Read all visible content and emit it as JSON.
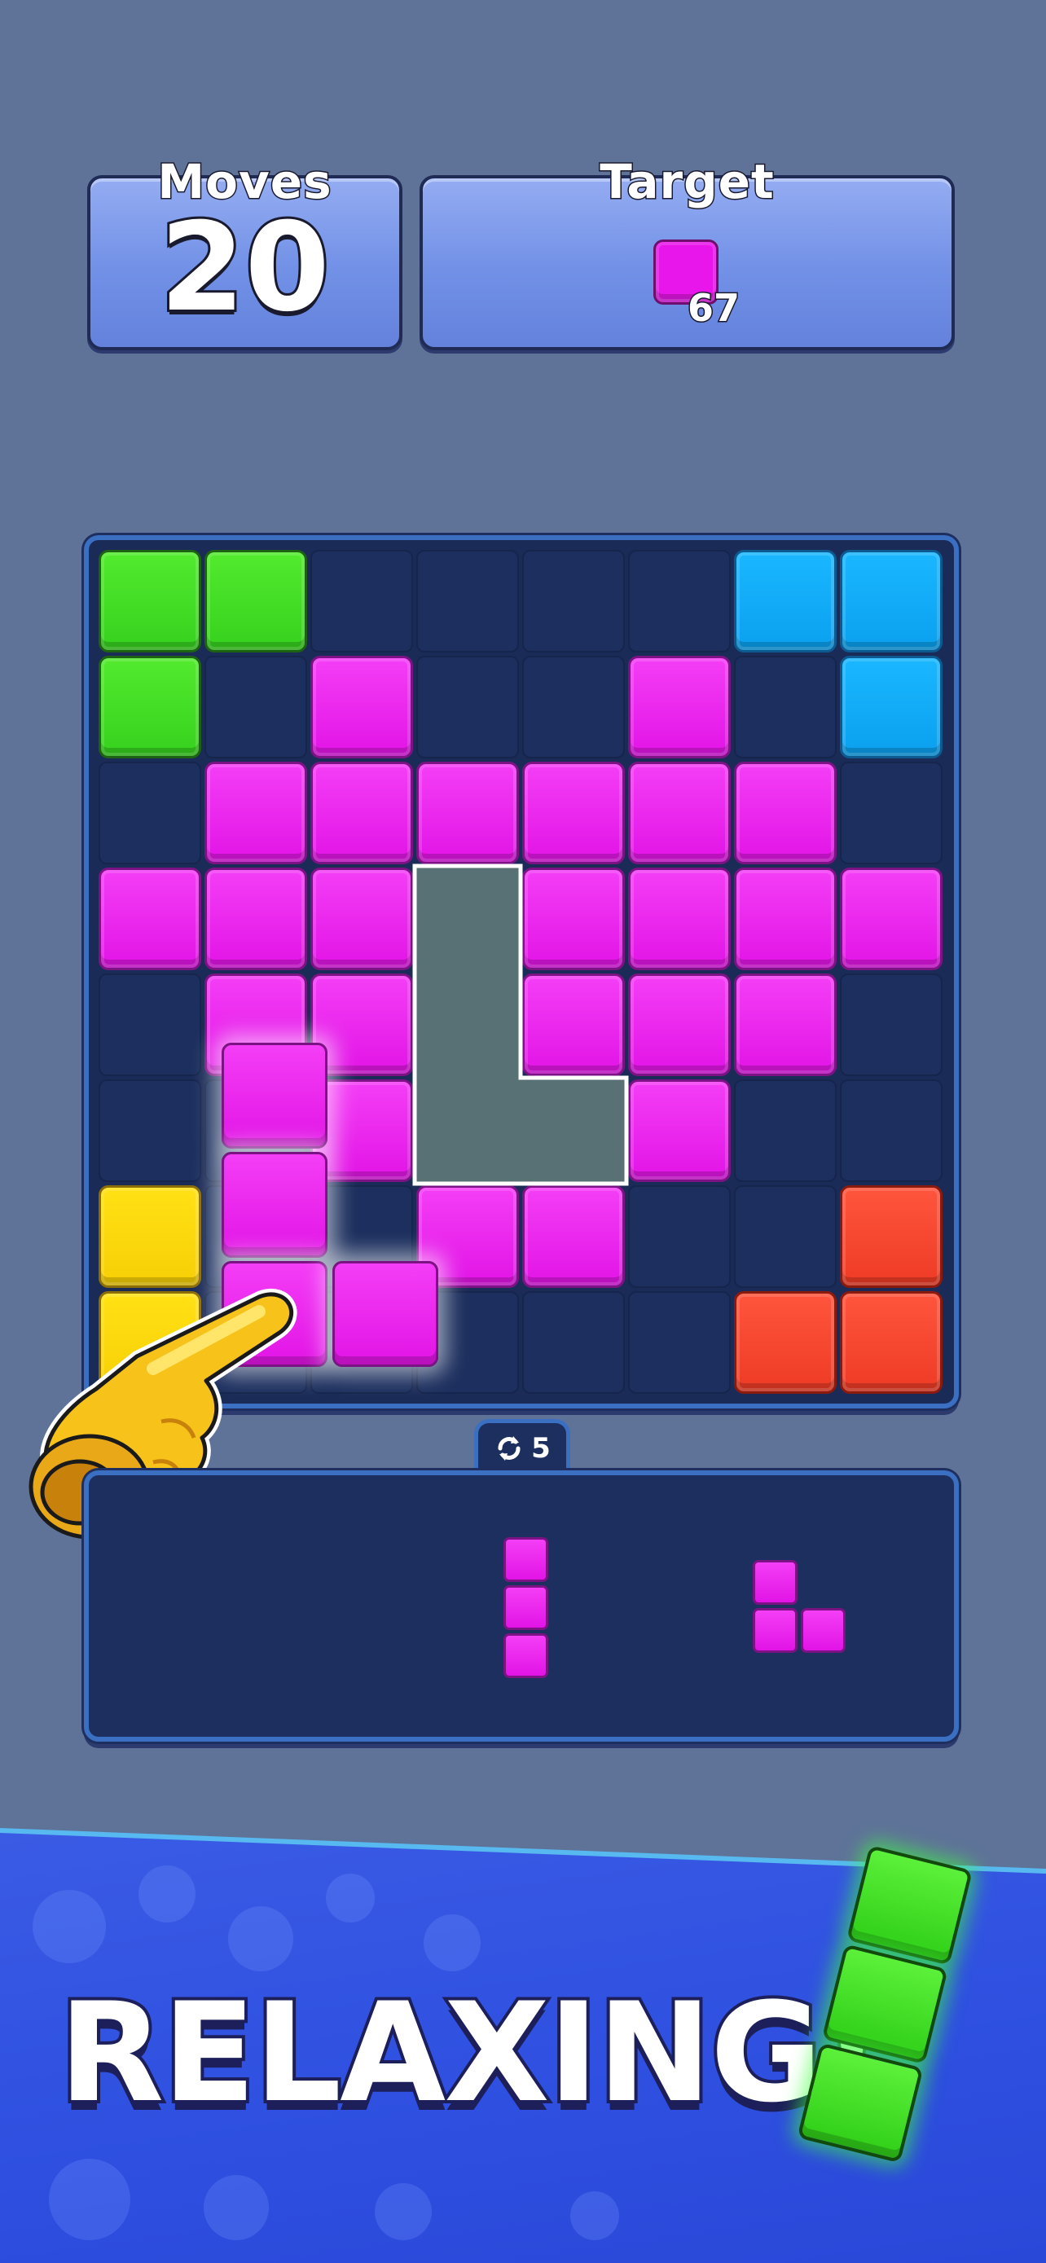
{
  "hud": {
    "moves_label": "Moves",
    "moves_value": "20",
    "target_label": "Target",
    "target_count": "67",
    "target_color": "#e816ea"
  },
  "board": {
    "rows": 8,
    "cols": 8,
    "grid": [
      [
        "G",
        "G",
        ".",
        ".",
        ".",
        ".",
        "B",
        "B"
      ],
      [
        "G",
        ".",
        "M",
        ".",
        ".",
        "M",
        ".",
        "B"
      ],
      [
        ".",
        "M",
        "M",
        "M",
        "M",
        "M",
        "M",
        "."
      ],
      [
        "M",
        "M",
        "M",
        ".",
        "M",
        "M",
        "M",
        "M"
      ],
      [
        ".",
        "M",
        "M",
        ".",
        "M",
        "M",
        "M",
        "."
      ],
      [
        ".",
        ".",
        "M",
        ".",
        ".",
        "M",
        ".",
        "."
      ],
      [
        "Y",
        ".",
        ".",
        "M",
        "M",
        ".",
        ".",
        "R"
      ],
      [
        "Y",
        ".",
        ".",
        ".",
        ".",
        ".",
        "R",
        "R"
      ]
    ],
    "colors": {
      "M": "magenta",
      "G": "green",
      "B": "blue",
      "Y": "yellow",
      "R": "red"
    },
    "placement_preview_shape": "L"
  },
  "rotate_count": "5",
  "tray": {
    "pieces": [
      "I-vertical-3",
      "L-small"
    ]
  },
  "banner": {
    "text": "RELAXING!"
  },
  "icons": [
    "rotate-icon",
    "pointing-hand-icon"
  ]
}
